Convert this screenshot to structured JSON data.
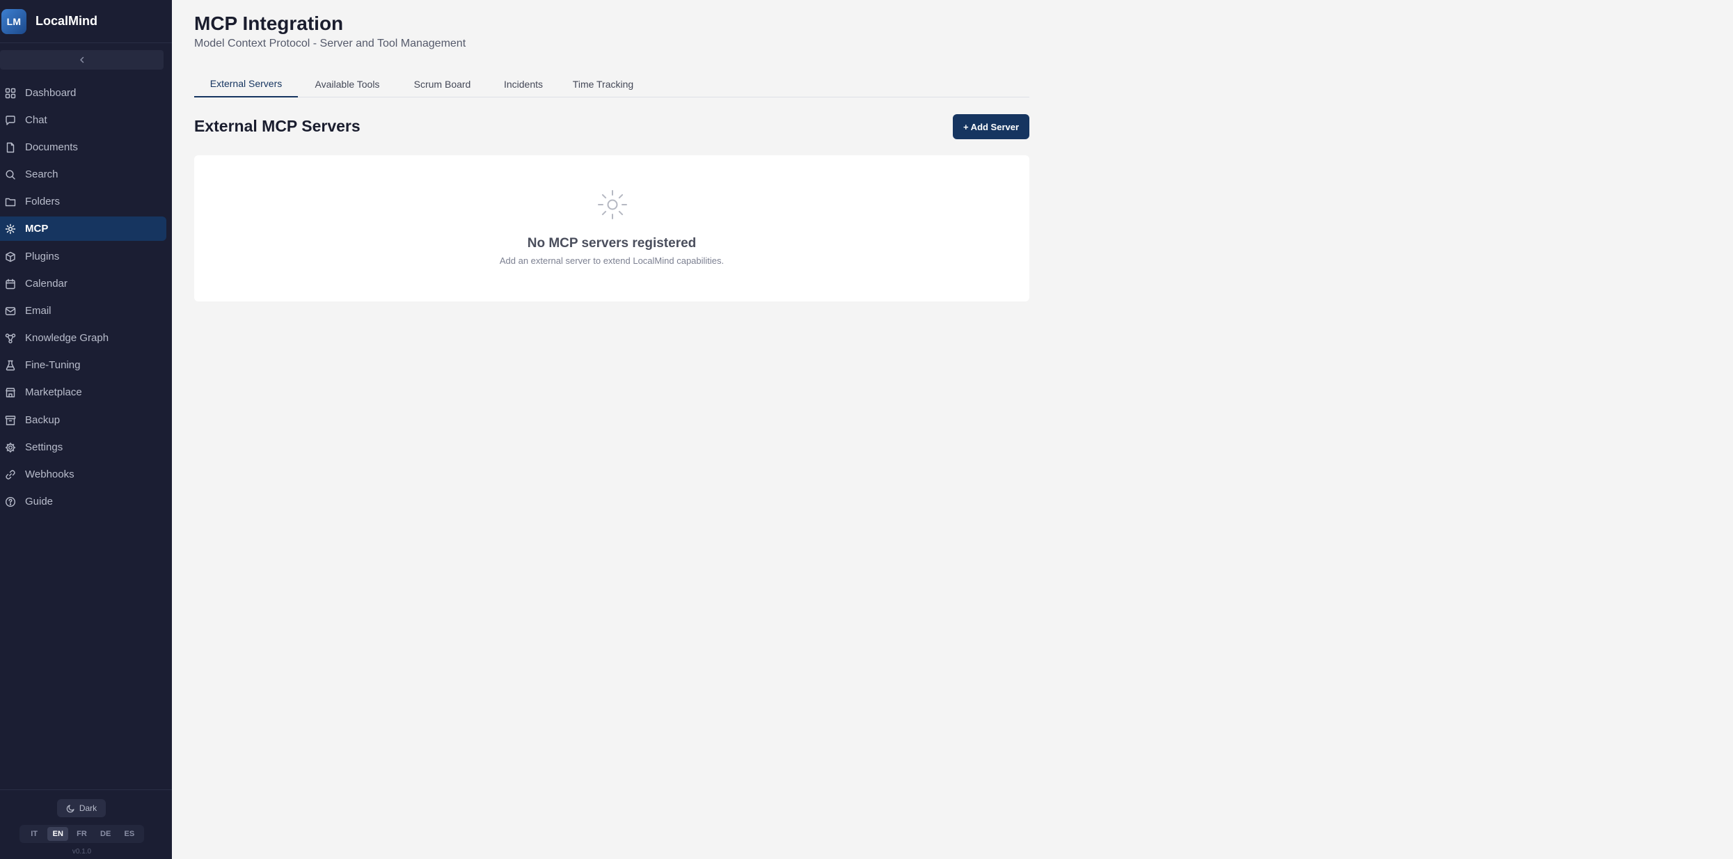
{
  "brand": {
    "logo_text": "LM",
    "name": "LocalMind"
  },
  "sidebar": {
    "collapse_icon": "chevron-left-icon",
    "items": [
      {
        "label": "Dashboard",
        "icon": "dashboard-icon",
        "active": false
      },
      {
        "label": "Chat",
        "icon": "chat-icon",
        "active": false
      },
      {
        "label": "Documents",
        "icon": "document-icon",
        "active": false
      },
      {
        "label": "Search",
        "icon": "search-icon",
        "active": false
      },
      {
        "label": "Folders",
        "icon": "folder-icon",
        "active": false
      },
      {
        "label": "MCP",
        "icon": "mcp-icon",
        "active": true
      },
      {
        "label": "Plugins",
        "icon": "plugin-icon",
        "active": false
      },
      {
        "label": "Calendar",
        "icon": "calendar-icon",
        "active": false
      },
      {
        "label": "Email",
        "icon": "email-icon",
        "active": false
      },
      {
        "label": "Knowledge Graph",
        "icon": "graph-icon",
        "active": false
      },
      {
        "label": "Fine-Tuning",
        "icon": "flask-icon",
        "active": false
      },
      {
        "label": "Marketplace",
        "icon": "store-icon",
        "active": false
      },
      {
        "label": "Backup",
        "icon": "archive-icon",
        "active": false
      },
      {
        "label": "Settings",
        "icon": "gear-icon",
        "active": false
      },
      {
        "label": "Webhooks",
        "icon": "link-icon",
        "active": false
      },
      {
        "label": "Guide",
        "icon": "help-icon",
        "active": false
      }
    ],
    "footer": {
      "theme_label": "Dark",
      "theme_icon": "moon-icon",
      "languages": [
        "IT",
        "EN",
        "FR",
        "DE",
        "ES"
      ],
      "active_language": "EN",
      "version": "v0.1.0"
    }
  },
  "header": {
    "title": "MCP Integration",
    "subtitle": "Model Context Protocol - Server and Tool Management"
  },
  "tabs": [
    {
      "label": "External Servers",
      "active": true
    },
    {
      "label": "Available Tools",
      "active": false
    },
    {
      "label": "Scrum Board",
      "active": false
    },
    {
      "label": "Incidents",
      "active": false
    },
    {
      "label": "Time Tracking",
      "active": false
    }
  ],
  "section": {
    "title": "External MCP Servers",
    "add_button_label": "+ Add Server"
  },
  "empty_state": {
    "icon": "mcp-icon",
    "title": "No MCP servers registered",
    "description": "Add an external server to extend LocalMind capabilities."
  },
  "colors": {
    "sidebar_bg": "#1b1e33",
    "accent": "#163560",
    "page_bg": "#f4f4f4"
  }
}
